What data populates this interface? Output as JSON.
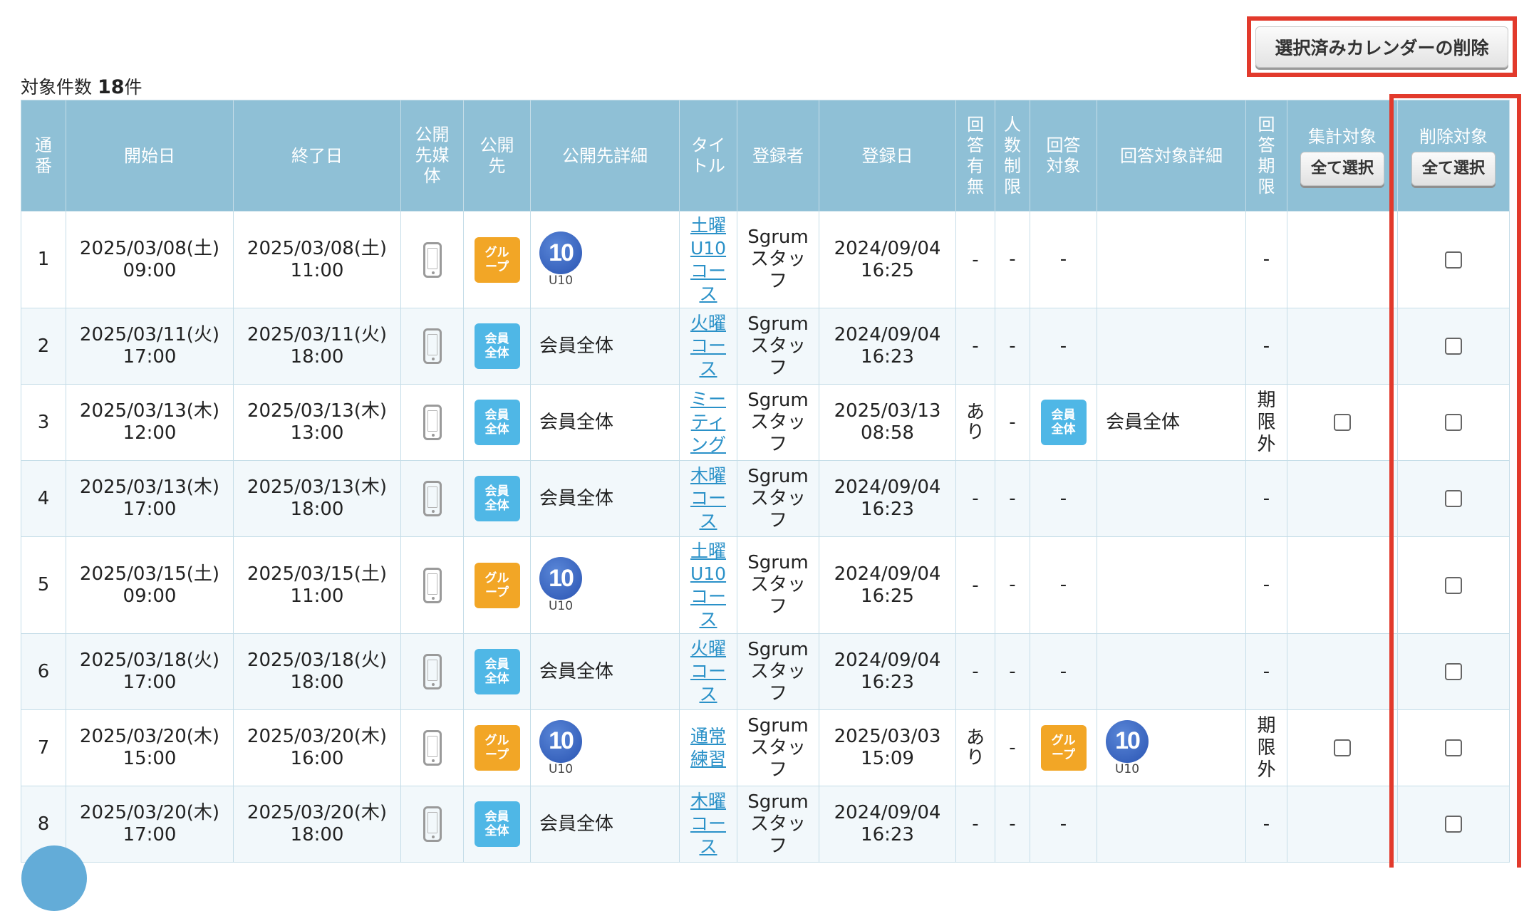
{
  "header": {
    "delete_selected_button": "選択済みカレンダーの削除",
    "count_label": "対象件数",
    "count_value": "18",
    "count_unit": "件"
  },
  "columns": {
    "no": [
      "通",
      "番"
    ],
    "start": "開始日",
    "end": "終了日",
    "media": [
      "公開",
      "先媒",
      "体"
    ],
    "target": [
      "公開",
      "先"
    ],
    "target_detail": "公開先詳細",
    "title": [
      "タイ",
      "トル"
    ],
    "registrant": "登録者",
    "reg_date": "登録日",
    "answer": [
      "回",
      "答",
      "有",
      "無"
    ],
    "limit": [
      "人",
      "数",
      "制",
      "限"
    ],
    "answer_target": [
      "回答",
      "対象"
    ],
    "answer_target_detail": "回答対象詳細",
    "answer_deadline": [
      "回",
      "答",
      "期",
      "限"
    ],
    "aggregate": "集計対象",
    "delete": "削除対象",
    "select_all": "全て選択"
  },
  "badges": {
    "group": [
      "グル",
      "ープ"
    ],
    "member": [
      "会員",
      "全体"
    ],
    "u10_number": "10",
    "u10_label": "U10"
  },
  "rows": [
    {
      "no": "1",
      "start_date": "2025/03/08(土)",
      "start_time": "09:00",
      "end_date": "2025/03/08(土)",
      "end_time": "11:00",
      "target": "group",
      "detail": "",
      "title": [
        "土曜",
        "U10",
        "コー",
        "ス"
      ],
      "registrant": [
        "Sgrum",
        "スタッ",
        "フ"
      ],
      "reg_date": "2024/09/04",
      "reg_time": "16:25",
      "answer": "-",
      "limit": "-",
      "answer_target": "-",
      "answer_detail": "",
      "deadline": [
        "-"
      ]
    },
    {
      "no": "2",
      "start_date": "2025/03/11(火)",
      "start_time": "17:00",
      "end_date": "2025/03/11(火)",
      "end_time": "18:00",
      "target": "member",
      "detail": "会員全体",
      "title": [
        "火曜",
        "コー",
        "ス"
      ],
      "registrant": [
        "Sgrum",
        "スタッ",
        "フ"
      ],
      "reg_date": "2024/09/04",
      "reg_time": "16:23",
      "answer": "-",
      "limit": "-",
      "answer_target": "-",
      "answer_detail": "",
      "deadline": [
        "-"
      ]
    },
    {
      "no": "3",
      "start_date": "2025/03/13(木)",
      "start_time": "12:00",
      "end_date": "2025/03/13(木)",
      "end_time": "13:00",
      "target": "member",
      "detail": "会員全体",
      "title": [
        "ミー",
        "ティ",
        "ング"
      ],
      "registrant": [
        "Sgrum",
        "スタッ",
        "フ"
      ],
      "reg_date": "2025/03/13",
      "reg_time": "08:58",
      "answer": "あり",
      "limit": "-",
      "answer_target": "member",
      "answer_detail": "会員全体",
      "deadline": [
        "期",
        "限",
        "外"
      ]
    },
    {
      "no": "4",
      "start_date": "2025/03/13(木)",
      "start_time": "17:00",
      "end_date": "2025/03/13(木)",
      "end_time": "18:00",
      "target": "member",
      "detail": "会員全体",
      "title": [
        "木曜",
        "コー",
        "ス"
      ],
      "registrant": [
        "Sgrum",
        "スタッ",
        "フ"
      ],
      "reg_date": "2024/09/04",
      "reg_time": "16:23",
      "answer": "-",
      "limit": "-",
      "answer_target": "-",
      "answer_detail": "",
      "deadline": [
        "-"
      ]
    },
    {
      "no": "5",
      "start_date": "2025/03/15(土)",
      "start_time": "09:00",
      "end_date": "2025/03/15(土)",
      "end_time": "11:00",
      "target": "group",
      "detail": "",
      "title": [
        "土曜",
        "U10",
        "コー",
        "ス"
      ],
      "registrant": [
        "Sgrum",
        "スタッ",
        "フ"
      ],
      "reg_date": "2024/09/04",
      "reg_time": "16:25",
      "answer": "-",
      "limit": "-",
      "answer_target": "-",
      "answer_detail": "",
      "deadline": [
        "-"
      ]
    },
    {
      "no": "6",
      "start_date": "2025/03/18(火)",
      "start_time": "17:00",
      "end_date": "2025/03/18(火)",
      "end_time": "18:00",
      "target": "member",
      "detail": "会員全体",
      "title": [
        "火曜",
        "コー",
        "ス"
      ],
      "registrant": [
        "Sgrum",
        "スタッ",
        "フ"
      ],
      "reg_date": "2024/09/04",
      "reg_time": "16:23",
      "answer": "-",
      "limit": "-",
      "answer_target": "-",
      "answer_detail": "",
      "deadline": [
        "-"
      ]
    },
    {
      "no": "7",
      "start_date": "2025/03/20(木)",
      "start_time": "15:00",
      "end_date": "2025/03/20(木)",
      "end_time": "16:00",
      "target": "group",
      "detail": "",
      "title": [
        "通常",
        "練習"
      ],
      "registrant": [
        "Sgrum",
        "スタッ",
        "フ"
      ],
      "reg_date": "2025/03/03",
      "reg_time": "15:09",
      "answer": "あり",
      "limit": "-",
      "answer_target": "group",
      "answer_detail": "",
      "deadline": [
        "期",
        "限",
        "外"
      ]
    },
    {
      "no": "8",
      "start_date": "2025/03/20(木)",
      "start_time": "17:00",
      "end_date": "2025/03/20(木)",
      "end_time": "18:00",
      "target": "member",
      "detail": "会員全体",
      "title": [
        "木曜",
        "コー",
        "ス"
      ],
      "registrant": [
        "Sgrum",
        "スタッ",
        "フ"
      ],
      "reg_date": "2024/09/04",
      "reg_time": "16:23",
      "answer": "-",
      "limit": "-",
      "answer_target": "-",
      "answer_detail": "",
      "deadline": [
        "-"
      ]
    }
  ],
  "icons": {
    "media": "smartphone-icon",
    "u10": "u10-group-icon"
  },
  "colors": {
    "header_bg": "#8fc0d6",
    "highlight": "#e23a2c",
    "link": "#2a91c8",
    "group_badge": "#f2a626",
    "member_badge": "#4fb7e6"
  }
}
